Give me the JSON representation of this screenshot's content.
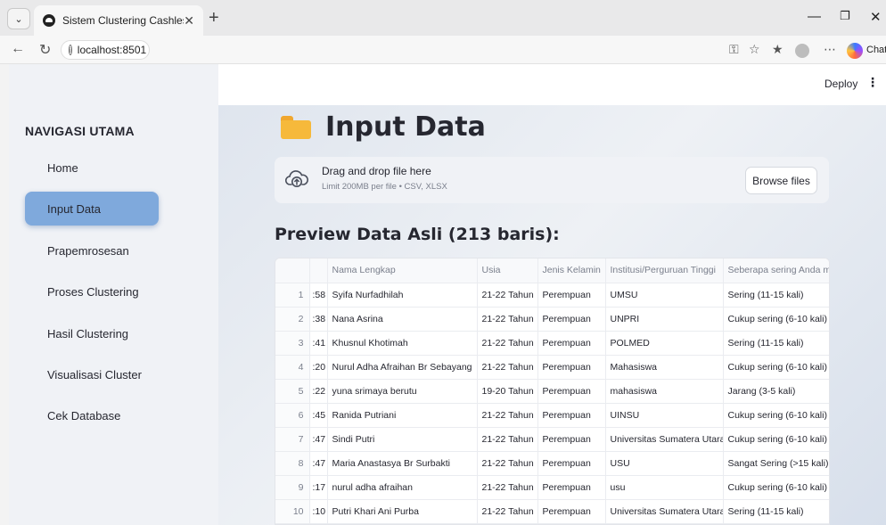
{
  "browser": {
    "tab_title": "Sistem Clustering Cashless",
    "url": "localhost:8501",
    "chat_label": "Chat"
  },
  "topbar": {
    "deploy_label": "Deploy"
  },
  "sidebar": {
    "heading": "NAVIGASI UTAMA",
    "items": [
      {
        "label": "Home",
        "active": false
      },
      {
        "label": "Input Data",
        "active": true
      },
      {
        "label": "Prapemrosesan",
        "active": false
      },
      {
        "label": "Proses Clustering",
        "active": false
      },
      {
        "label": "Hasil Clustering",
        "active": false
      },
      {
        "label": "Visualisasi Cluster",
        "active": false
      },
      {
        "label": "Cek Database",
        "active": false
      }
    ]
  },
  "main": {
    "title": "Input Data",
    "uploader": {
      "main_text": "Drag and drop file here",
      "sub_text": "Limit 200MB per file • CSV, XLSX",
      "browse_label": "Browse files"
    },
    "preview_title": "Preview Data Asli (213 baris):",
    "table": {
      "columns": [
        "",
        "",
        "Nama Lengkap",
        "Usia",
        "Jenis Kelamin",
        "Institusi/Perguruan Tinggi",
        "Seberapa sering Anda mer"
      ],
      "rows": [
        [
          "1",
          ":58",
          "Syifa Nurfadhilah",
          "21-22 Tahun",
          "Perempuan",
          "UMSU",
          "Sering (11-15 kali)"
        ],
        [
          "2",
          ":38",
          "Nana Asrina",
          "21-22 Tahun",
          "Perempuan",
          "UNPRI",
          "Cukup sering (6-10 kali)"
        ],
        [
          "3",
          ":41",
          "Khusnul Khotimah",
          "21-22 Tahun",
          "Perempuan",
          "POLMED",
          "Sering (11-15 kali)"
        ],
        [
          "4",
          ":20",
          "Nurul Adha Afraihan Br Sebayang",
          "21-22 Tahun",
          "Perempuan",
          "Mahasiswa",
          "Cukup sering (6-10 kali)"
        ],
        [
          "5",
          ":22",
          "yuna srimaya berutu",
          "19-20 Tahun",
          "Perempuan",
          "mahasiswa",
          "Jarang (3-5 kali)"
        ],
        [
          "6",
          ":45",
          "Ranida Putriani",
          "21-22 Tahun",
          "Perempuan",
          "UINSU",
          "Cukup sering (6-10 kali)"
        ],
        [
          "7",
          ":47",
          "Sindi Putri",
          "21-22 Tahun",
          "Perempuan",
          "Universitas Sumatera Utara",
          "Cukup sering (6-10 kali)"
        ],
        [
          "8",
          ":47",
          "Maria Anastasya Br Surbakti",
          "21-22 Tahun",
          "Perempuan",
          "USU",
          "Sangat Sering (>15 kali)"
        ],
        [
          "9",
          ":17",
          "nurul adha afraihan",
          "21-22 Tahun",
          "Perempuan",
          "usu",
          "Cukup sering (6-10 kali)"
        ],
        [
          "10",
          ":10",
          "Putri Khari Ani Purba",
          "21-22 Tahun",
          "Perempuan",
          "Universitas Sumatera Utara",
          "Sering (11-15 kali)"
        ]
      ]
    }
  }
}
